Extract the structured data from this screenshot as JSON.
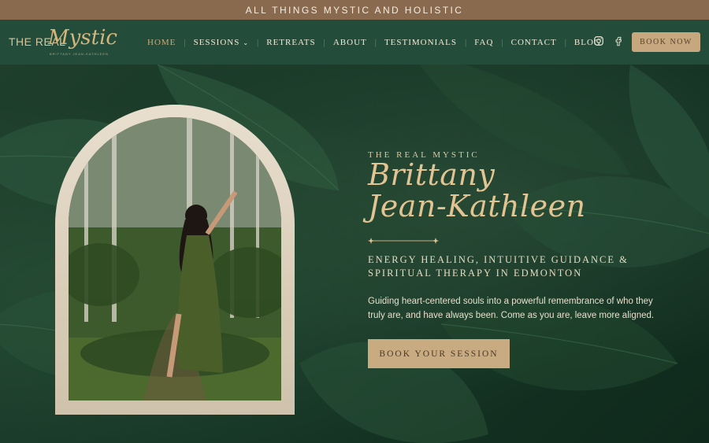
{
  "topbar": {
    "text": "ALL THINGS MYSTIC AND HOLISTIC"
  },
  "logo": {
    "the_real": "THE REAL",
    "mystic": "Mystic",
    "tagline": "BRITTANY JEAN-KATHLEEN"
  },
  "nav": {
    "items": [
      {
        "label": "HOME",
        "active": true
      },
      {
        "label": "SESSIONS",
        "has_dropdown": true
      },
      {
        "label": "RETREATS"
      },
      {
        "label": "ABOUT"
      },
      {
        "label": "TESTIMONIALS"
      },
      {
        "label": "FAQ"
      },
      {
        "label": "CONTACT"
      },
      {
        "label": "BLOG"
      }
    ],
    "book_label": "BOOK NOW",
    "social": [
      "instagram-icon",
      "facebook-icon"
    ]
  },
  "hero": {
    "eyebrow": "THE REAL MYSTIC",
    "name_line1": "Brittany",
    "name_line2": "Jean-Kathleen",
    "subhead": "ENERGY HEALING, INTUITIVE GUIDANCE & SPIRITUAL THERAPY IN EDMONTON",
    "body": "Guiding heart-centered souls into a powerful remembrance of who they truly are, and have always been. Come as you are, leave more aligned.",
    "cta_label": "BOOK YOUR SESSION"
  },
  "colors": {
    "nav_bg": "#234d3a",
    "topbar_bg": "#8a6a4f",
    "gold": "#c9ab82",
    "script_gold": "#e2c493"
  }
}
